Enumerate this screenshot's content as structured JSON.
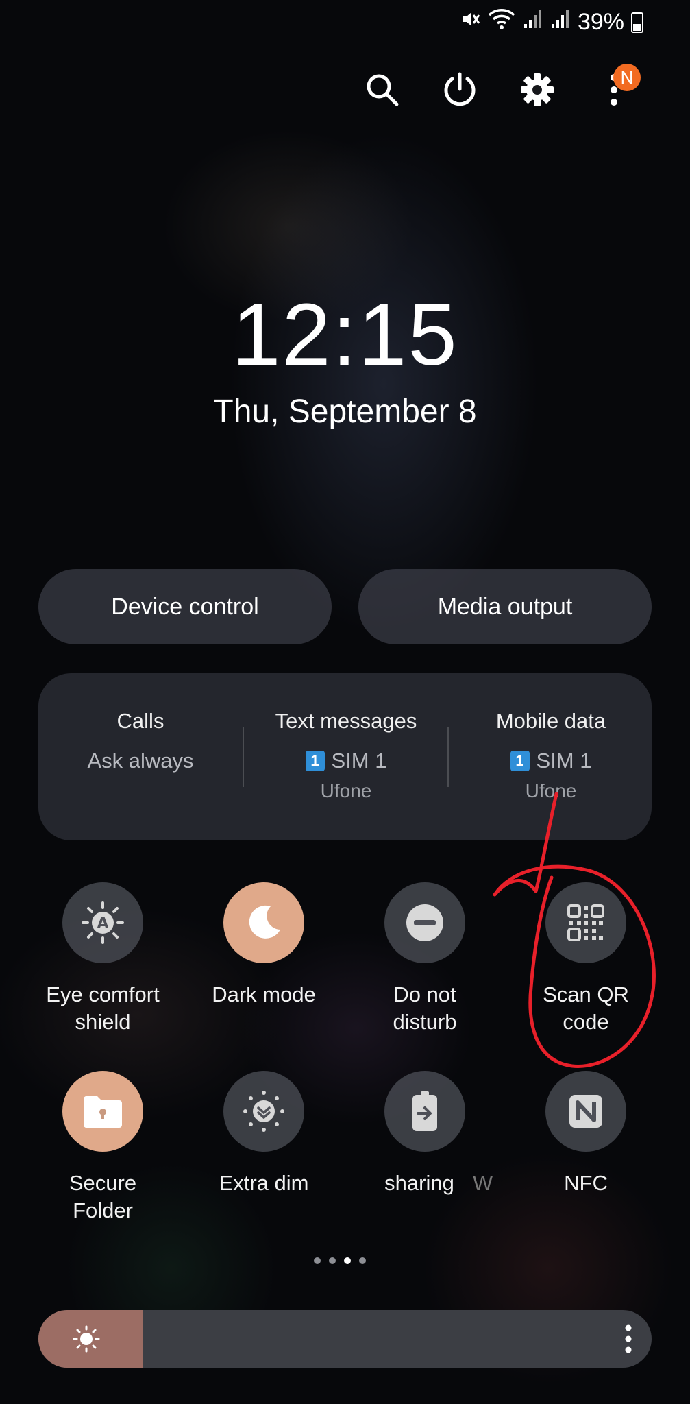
{
  "status_bar": {
    "battery": "39%",
    "icons": [
      "mute-icon",
      "wifi-icon",
      "signal-icon",
      "signal-icon",
      "battery-icon"
    ]
  },
  "header": {
    "notification_badge": "N",
    "icons": [
      "search-icon",
      "power-icon",
      "settings-gear-icon",
      "more-vert-icon"
    ]
  },
  "clock": {
    "time": "12:15",
    "date": "Thu, September 8"
  },
  "pills": {
    "device_control": "Device control",
    "media_output": "Media output"
  },
  "sim_panel": {
    "calls": {
      "title": "Calls",
      "value": "Ask always"
    },
    "text_messages": {
      "title": "Text messages",
      "sim_badge": "1",
      "value": "SIM 1",
      "carrier": "Ufone"
    },
    "mobile_data": {
      "title": "Mobile data",
      "sim_badge": "1",
      "value": "SIM 1",
      "carrier": "Ufone"
    }
  },
  "tiles_row1": [
    {
      "line1": "Eye comfort",
      "line2": "shield",
      "icon": "eye-comfort-icon",
      "active": false
    },
    {
      "line1": "Dark mode",
      "line2": "",
      "icon": "moon-icon",
      "active": true
    },
    {
      "line1": "Do not",
      "line2": "disturb",
      "icon": "do-not-disturb-icon",
      "active": false
    },
    {
      "line1": "Scan QR",
      "line2": "code",
      "icon": "qr-code-icon",
      "active": false
    }
  ],
  "tiles_row2": [
    {
      "line1": "Secure",
      "line2": "Folder",
      "icon": "secure-folder-icon",
      "active": true
    },
    {
      "line1": "Extra dim",
      "line2": "",
      "icon": "extra-dim-icon",
      "active": false
    },
    {
      "line1": "sharing",
      "line2": "",
      "icon": "battery-share-icon",
      "active": false
    },
    {
      "line1": "W",
      "line2": "",
      "icon": "",
      "active": false
    },
    {
      "line1": "NFC",
      "line2": "",
      "icon": "nfc-icon",
      "active": false
    }
  ],
  "pager": {
    "total": 4,
    "active": 3
  },
  "brightness": {
    "level": 0.17
  },
  "colors": {
    "accent": "#e0a98a",
    "badge": "#f26b22",
    "annotation": "#e8202a",
    "sim_badge": "#2f8fd8"
  }
}
